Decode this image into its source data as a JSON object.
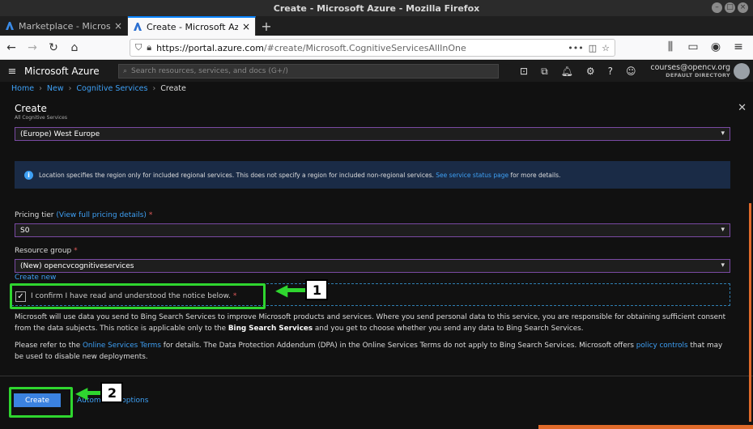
{
  "window": {
    "title": "Create - Microsoft Azure - Mozilla Firefox"
  },
  "tabs": [
    {
      "label": "Marketplace - Microsoft"
    },
    {
      "label": "Create - Microsoft Azure"
    }
  ],
  "urlbar": {
    "host": "https://portal.azure.com",
    "path": "/#create/Microsoft.CognitiveServicesAllInOne"
  },
  "azure": {
    "brand": "Microsoft Azure",
    "search_placeholder": "Search resources, services, and docs (G+/)",
    "user_email": "courses@opencv.org",
    "user_directory": "DEFAULT DIRECTORY"
  },
  "breadcrumb": [
    "Home",
    "New",
    "Cognitive Services",
    "Create"
  ],
  "panel": {
    "title": "Create",
    "subtitle": "All Cognitive Services",
    "location_value": "(Europe) West Europe",
    "info_text": "Location specifies the region only for included regional services. This does not specify a region for included non-regional services.",
    "info_link": "See service status page",
    "info_tail": "for more details.",
    "pricing_label": "Pricing tier",
    "pricing_link": "(View full pricing details)",
    "pricing_value": "S0",
    "rg_label": "Resource group",
    "rg_value": "(New) opencvcognitiveservices",
    "create_new": "Create new",
    "confirm_text": "I confirm I have read and understood the notice below.",
    "required_mark": "*",
    "notice_p1_a": "Microsoft will use data you send to Bing Search Services to improve Microsoft products and services. Where you send personal data to this service, you are responsible for obtaining sufficient consent from the data subjects. This notice is applicable only to the",
    "notice_p1_bold": "Bing Search Services",
    "notice_p1_b": "and you get to choose whether you send any data to Bing Search Services.",
    "notice_p2_a": "Please refer to the",
    "notice_p2_link1": "Online Services Terms",
    "notice_p2_b": "for details. The Data Protection Addendum (DPA) in the Online Services Terms do not apply to Bing Search Services. Microsoft offers",
    "notice_p2_link2": "policy controls",
    "notice_p2_c": "that may be used to disable new deployments.",
    "create_button": "Create",
    "automation_link": "Automation options"
  },
  "callouts": [
    "1",
    "2"
  ],
  "colors": {
    "highlight": "#2fd62f",
    "link": "#3ea0f5",
    "primary_button": "#3b82e0"
  }
}
